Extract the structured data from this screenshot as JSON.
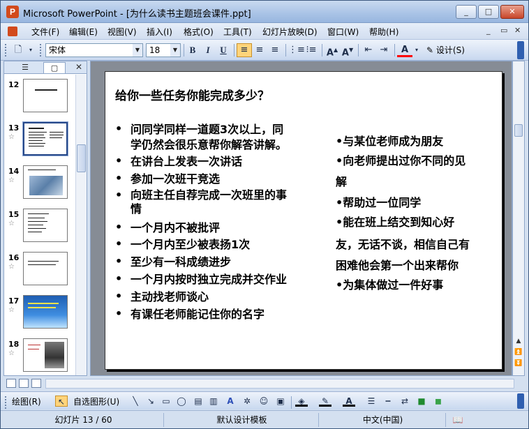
{
  "window": {
    "title": "Microsoft PowerPoint - [为什么读书主题班会课件.ppt]",
    "app_icon": "powerpoint-icon",
    "minimize": "_",
    "maximize": "□",
    "close": "✕"
  },
  "menu": {
    "items": [
      "文件(F)",
      "编辑(E)",
      "视图(V)",
      "插入(I)",
      "格式(O)",
      "工具(T)",
      "幻灯片放映(D)",
      "窗口(W)",
      "帮助(H)"
    ],
    "mdi_minimize": "_",
    "mdi_restore": "▭",
    "mdi_close": "✕"
  },
  "toolbar": {
    "font_name": "宋体",
    "font_size": "18",
    "bold": "B",
    "italic": "I",
    "underline": "U",
    "design_label": "设计(S)",
    "font_color": "#ff0000"
  },
  "panel": {
    "tab_outline": "☰",
    "tab_slides": "▢",
    "close": "✕",
    "thumbnails": [
      {
        "num": "12",
        "star": "",
        "kind": "text",
        "selected": false
      },
      {
        "num": "13",
        "star": "☆",
        "kind": "text",
        "selected": true
      },
      {
        "num": "14",
        "star": "☆",
        "kind": "photo",
        "selected": false
      },
      {
        "num": "15",
        "star": "☆",
        "kind": "text",
        "selected": false
      },
      {
        "num": "16",
        "star": "☆",
        "kind": "text",
        "selected": false
      },
      {
        "num": "17",
        "star": "☆",
        "kind": "blue",
        "selected": false
      },
      {
        "num": "18",
        "star": "☆",
        "kind": "photo2",
        "selected": false
      }
    ]
  },
  "slide": {
    "title": "给你一些任务你能完成多少？",
    "left_bullets": [
      "问同学同样一道题3次以上，同\n学仍然会很乐意帮你解答讲解。",
      "在讲台上发表一次讲话",
      "参加一次班干竞选",
      "向班主任自荐完成一次班里的事\n情",
      "一个月内不被批评",
      "一个月内至少被表扬1次",
      "至少有一科成绩进步",
      "一个月内按时独立完成并交作业",
      "主动找老师谈心",
      "有课任老师能记住你的名字"
    ],
    "bullet_char": "•",
    "right_lines": [
      "•与某位老师成为朋友",
      "•向老师提出过你不同的见",
      "解",
      "•帮助过一位同学",
      "•能在班上结交到知心好",
      "友，无话不谈，相信自己有",
      "困难他会第一个出来帮你",
      "•为集体做过一件好事"
    ]
  },
  "drawbar": {
    "draw_label": "绘图(R)",
    "autoshape_label": "自选图形(U)"
  },
  "status": {
    "slide_pos": "幻灯片 13 / 60",
    "template": "默认设计模板",
    "language": "中文(中国)"
  }
}
